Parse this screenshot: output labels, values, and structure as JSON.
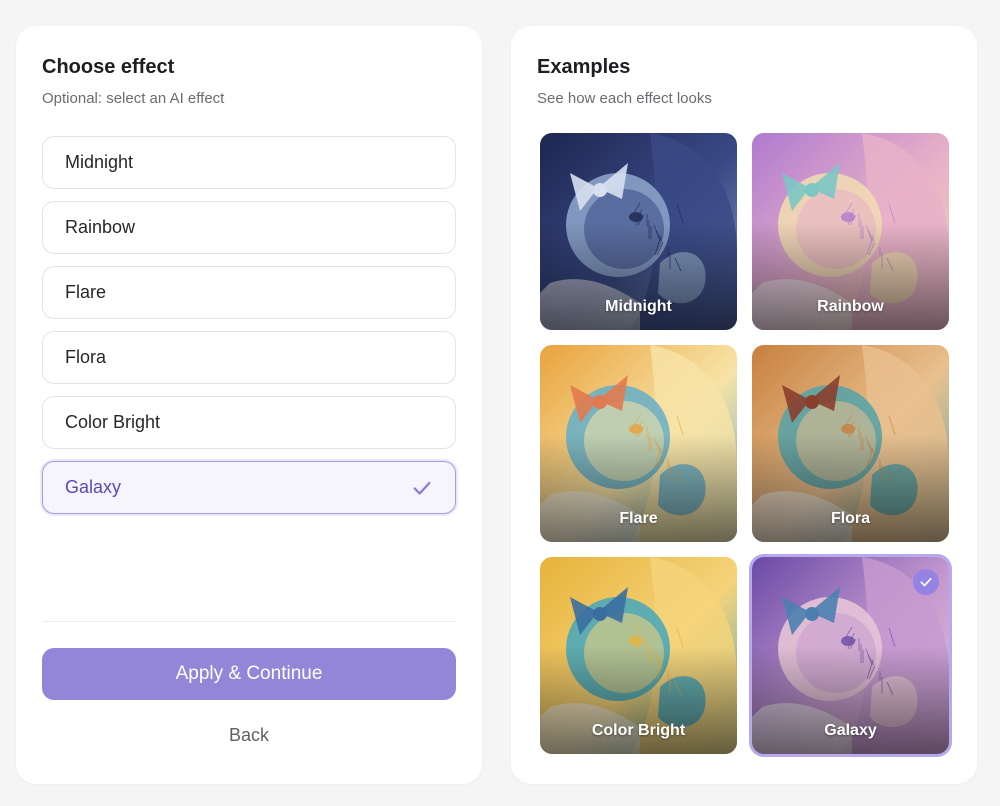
{
  "left": {
    "title": "Choose effect",
    "subtitle": "Optional: select an AI effect",
    "options": [
      {
        "label": "Midnight",
        "selected": false
      },
      {
        "label": "Rainbow",
        "selected": false
      },
      {
        "label": "Flare",
        "selected": false
      },
      {
        "label": "Flora",
        "selected": false
      },
      {
        "label": "Color Bright",
        "selected": false
      },
      {
        "label": "Galaxy",
        "selected": true
      }
    ],
    "apply_label": "Apply & Continue",
    "back_label": "Back"
  },
  "right": {
    "title": "Examples",
    "subtitle": "See how each effect looks",
    "examples": [
      {
        "label": "Midnight",
        "palette": [
          "#1e2650",
          "#3a4a86",
          "#8aa2c8",
          "#d8e0f0"
        ],
        "selected": false
      },
      {
        "label": "Rainbow",
        "palette": [
          "#b07ad0",
          "#e7b1c8",
          "#f1d9b4",
          "#7cc7c4"
        ],
        "selected": false
      },
      {
        "label": "Flare",
        "palette": [
          "#e9a23c",
          "#f7e3a6",
          "#6db0c4",
          "#e27a4f"
        ],
        "selected": false
      },
      {
        "label": "Flora",
        "palette": [
          "#c7803e",
          "#e9c08e",
          "#5aa3a6",
          "#8a3e2c"
        ],
        "selected": false
      },
      {
        "label": "Color Bright",
        "palette": [
          "#e7b33a",
          "#f4d37a",
          "#4ea8b8",
          "#3b6ea0"
        ],
        "selected": false
      },
      {
        "label": "Galaxy",
        "palette": [
          "#6a4aa6",
          "#c69ad0",
          "#e6c4d6",
          "#4b7fb0"
        ],
        "selected": true
      }
    ]
  },
  "colors": {
    "accent": "#9386d9",
    "accent_text": "#5a48b8",
    "accent_border": "#a99be6"
  },
  "icons": {
    "option_check": "check-icon",
    "thumb_badge": "check-circle-icon"
  }
}
